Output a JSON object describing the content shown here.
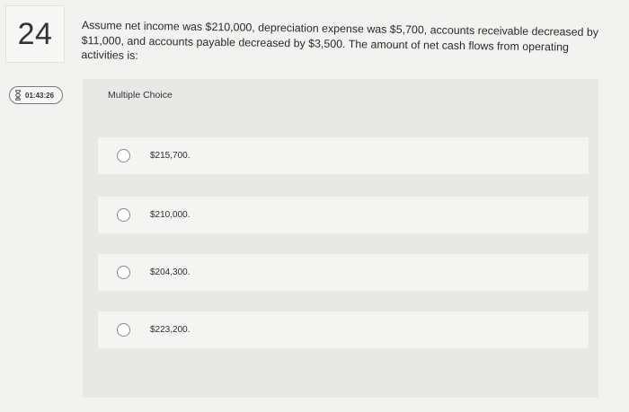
{
  "question": {
    "number": "24",
    "text": "Assume net income was $210,000, depreciation expense was $5,700, accounts receivable decreased by $11,000, and accounts payable decreased by $3,500. The amount of net cash flows from operating activities is:"
  },
  "timer": {
    "icon": "hourglass-icon",
    "value": "01:43:26"
  },
  "multiple_choice": {
    "header": "Multiple Choice",
    "options": [
      {
        "label": "$215,700."
      },
      {
        "label": "$210,000."
      },
      {
        "label": "$204,300."
      },
      {
        "label": "$223,200."
      }
    ]
  }
}
